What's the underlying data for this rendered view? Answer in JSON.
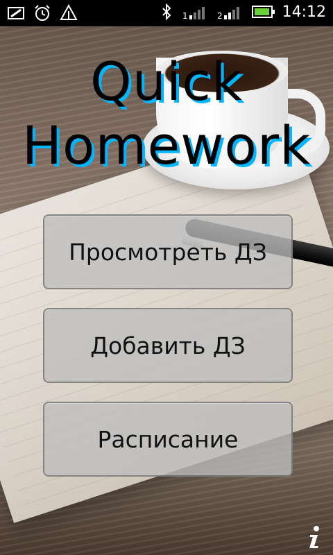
{
  "status_bar": {
    "time": "14:12",
    "left_icons": [
      "screen-orientation-icon",
      "alarm-icon",
      "data-transfer-icon"
    ],
    "right_icons": [
      "bluetooth-icon",
      "signal-1-icon",
      "signal-2-icon",
      "battery-icon"
    ],
    "signal_1_label": "1",
    "signal_2_label": "2"
  },
  "app": {
    "title_line1": "Quick",
    "title_line2": "Homework",
    "title_shadow_color": "#00b7ff"
  },
  "buttons": {
    "view_homework": "Просмотреть ДЗ",
    "add_homework": "Добавить ДЗ",
    "schedule": "Расписание"
  },
  "info_icon": "info-icon"
}
